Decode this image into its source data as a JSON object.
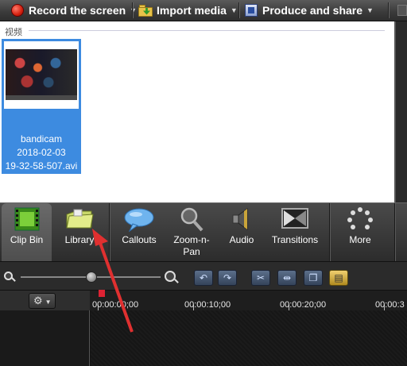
{
  "toolbar": {
    "record_label": "Record the screen",
    "import_label": "Import media",
    "share_label": "Produce and share"
  },
  "clip_bin": {
    "section_label": "视频",
    "media": [
      {
        "name_line1": "bandicam",
        "name_line2": "2018-02-03",
        "name_line3": "19-32-58-507.avi"
      }
    ]
  },
  "tabs": {
    "clip_bin": "Clip Bin",
    "library": "Library",
    "callouts": "Callouts",
    "zoom_n_pan_1": "Zoom-n-",
    "zoom_n_pan_2": "Pan",
    "audio": "Audio",
    "transitions": "Transitions",
    "more": "More"
  },
  "timeline": {
    "timecodes": [
      "00:00:00;00",
      "00:00:10;00",
      "00:00:20;00",
      "00:00:3"
    ]
  },
  "colors": {
    "selection": "#3d8be0",
    "annotation_arrow": "#e03030"
  },
  "icons": [
    "record-icon",
    "import-icon",
    "share-icon",
    "film-icon",
    "library-icon",
    "callout-icon",
    "zoom-icon",
    "audio-icon",
    "transitions-icon",
    "more-icon",
    "gear-icon",
    "undo-icon",
    "redo-icon",
    "cut-icon",
    "split-icon",
    "copy-icon",
    "paste-icon"
  ]
}
